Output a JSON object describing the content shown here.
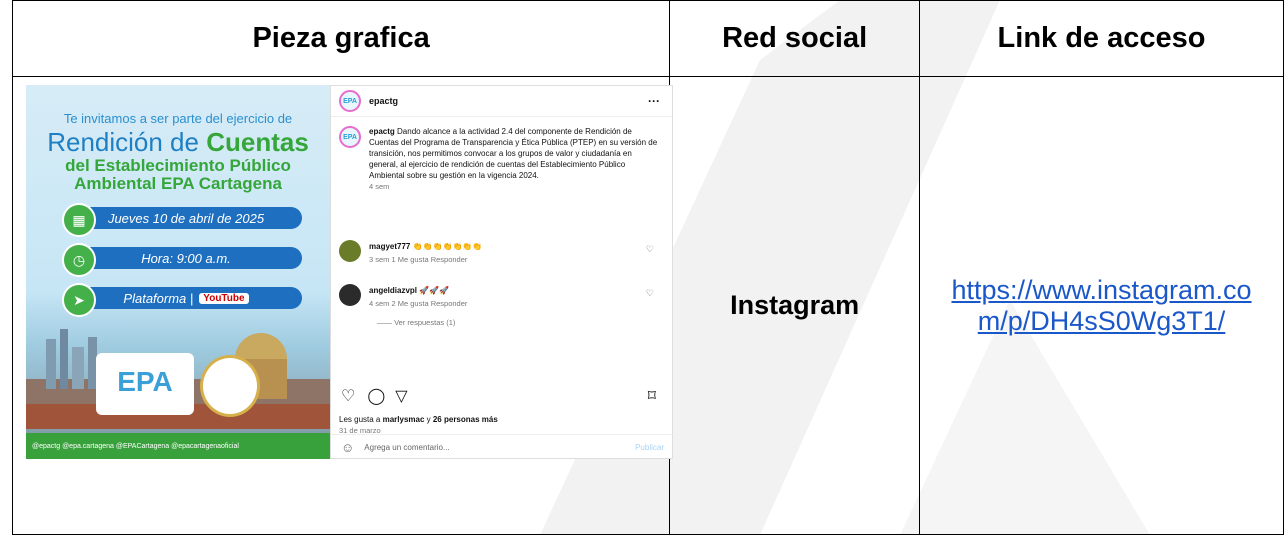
{
  "table": {
    "headers": [
      "Pieza grafica",
      "Red social",
      "Link de acceso"
    ],
    "row": {
      "red_social": "Instagram",
      "link": "https://www.instagram.com/p/DH4sS0Wg3T1/"
    }
  },
  "poster": {
    "invite": "Te invitamos a ser parte del ejercicio de",
    "title_a": "Rendición de ",
    "title_b": "Cuentas",
    "subtitle_1": "del Establecimiento Público",
    "subtitle_2": "Ambiental EPA Cartagena",
    "date": "Jueves 10 de abril de 2025",
    "time": "Hora: 9:00 a.m.",
    "platform": "Plataforma | ",
    "youtube": "YouTube",
    "logo": "EPA",
    "footer": "@epactg  @epa.cartagena  @EPACartagena  @epacartagenaoficial"
  },
  "instagram": {
    "username": "epactg",
    "avatar_text": "EPA",
    "more": "···",
    "caption": "Dando alcance a la actividad 2.4 del componente de Rendición de Cuentas del Programa de Transparencia y Ética Pública (PTEP) en su versión de transición, nos permitimos convocar a los grupos de valor y ciudadanía en general, al ejercicio de rendición de cuentas del Establecimiento Público Ambiental sobre su gestión en la vigencia 2024.",
    "caption_time": "4 sem",
    "comments": [
      {
        "user": "magyet777",
        "text": "👏👏👏👏👏👏👏",
        "meta": "3 sem   1 Me gusta   Responder"
      },
      {
        "user": "angeldiazvpl",
        "text": "🚀🚀🚀",
        "meta": "4 sem   2 Me gusta   Responder"
      }
    ],
    "view_replies": "—— Ver respuestas (1)",
    "likes_prefix": "Les gusta a ",
    "likes_user": "marlysmac",
    "likes_mid": " y ",
    "likes_count": "26 personas más",
    "date": "31 de marzo",
    "add_comment": "Agrega un comentario...",
    "publish": "Publicar"
  }
}
